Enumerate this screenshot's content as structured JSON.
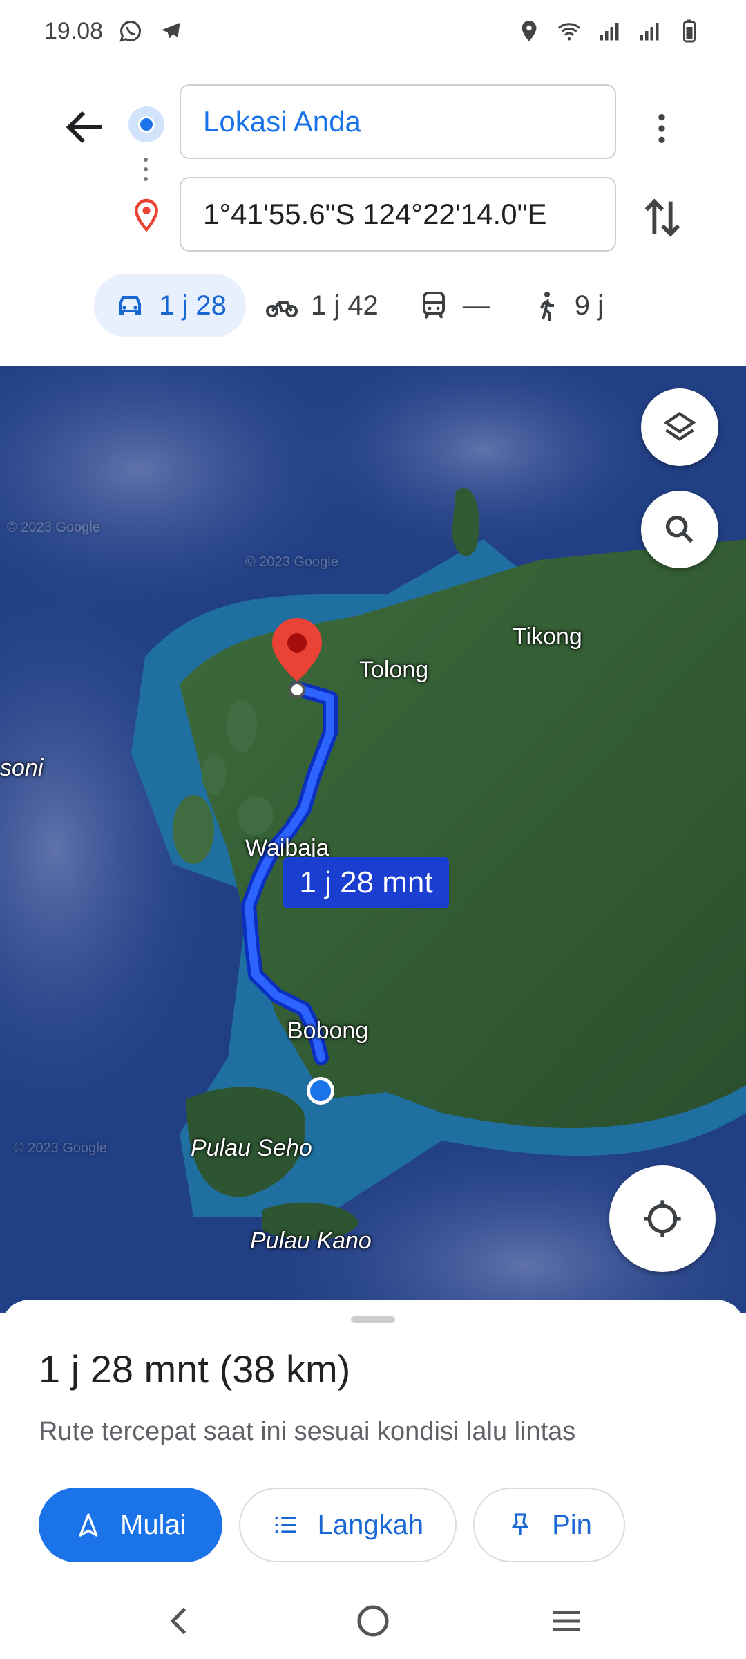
{
  "status_bar": {
    "time": "19.08",
    "left_icons": [
      "whatsapp-icon",
      "telegram-icon"
    ],
    "right_icons": [
      "location-icon",
      "wifi-icon",
      "signal-icon",
      "signal-icon",
      "battery-icon"
    ]
  },
  "directions": {
    "origin": "Lokasi Anda",
    "destination": "1°41'55.6\"S 124°22'14.0\"E",
    "modes": [
      {
        "icon": "car-icon",
        "label": "1 j 28",
        "selected": true
      },
      {
        "icon": "motorcycle-icon",
        "label": "1 j 42",
        "selected": false
      },
      {
        "icon": "transit-icon",
        "label": "—",
        "selected": false
      },
      {
        "icon": "walk-icon",
        "label": "9 j",
        "selected": false
      }
    ]
  },
  "map": {
    "watermarks": [
      "© 2023 Google",
      "© 2023 Google",
      "© 2023 Google"
    ],
    "places": [
      "Tikong",
      "Tolong",
      "soni",
      "Waibaja",
      "Bobong",
      "Pulau Seho",
      "Pulau Kano"
    ],
    "route_time_label": "1 j 28 mnt",
    "colors": {
      "route": "#1a3fff",
      "route_chip": "#1a3fd0",
      "destination_pin": "#ea4335",
      "origin_dot": "#1a73e8"
    }
  },
  "sheet": {
    "summary": "1 j 28 mnt (38 km)",
    "subtitle": "Rute tercepat saat ini sesuai kondisi lalu lintas",
    "buttons": {
      "start": "Mulai",
      "steps": "Langkah",
      "pin": "Pin"
    }
  },
  "colors": {
    "accent": "#1a73e8",
    "chip_bg": "#e8f0fe"
  }
}
